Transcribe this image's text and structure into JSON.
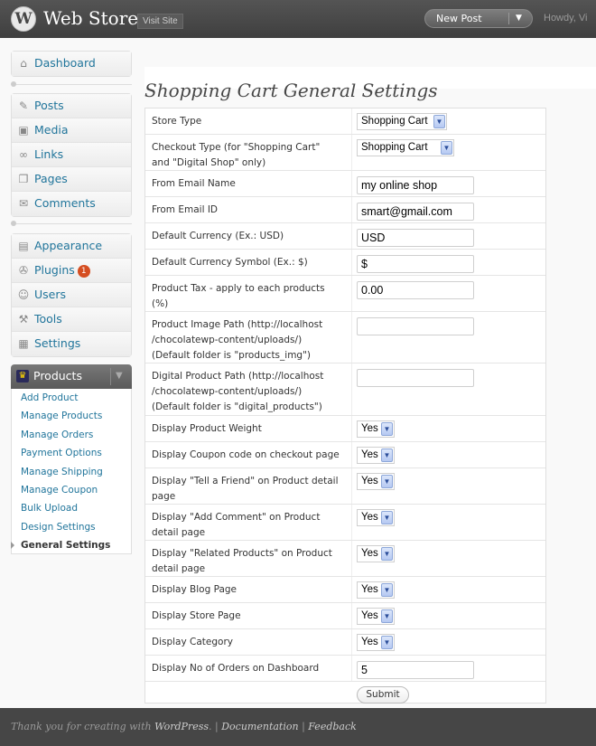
{
  "header": {
    "logo_glyph": "W",
    "site_title": "Web Store",
    "visit_site": "Visit Site",
    "new_post": "New Post",
    "new_post_arrow": "▼",
    "howdy": "Howdy, Vi"
  },
  "sidebar": {
    "group1": [
      {
        "label": "Dashboard",
        "icon": "house-icon",
        "glyph": "⌂"
      }
    ],
    "group2": [
      {
        "label": "Posts",
        "icon": "pin-icon",
        "glyph": "✎"
      },
      {
        "label": "Media",
        "icon": "media-icon",
        "glyph": "▣"
      },
      {
        "label": "Links",
        "icon": "link-icon",
        "glyph": "∞"
      },
      {
        "label": "Pages",
        "icon": "pages-icon",
        "glyph": "❐"
      },
      {
        "label": "Comments",
        "icon": "comment-icon",
        "glyph": "✉"
      }
    ],
    "group3": [
      {
        "label": "Appearance",
        "icon": "appearance-icon",
        "glyph": "▤"
      },
      {
        "label": "Plugins",
        "icon": "plugin-icon",
        "glyph": "✇",
        "badge": "1"
      },
      {
        "label": "Users",
        "icon": "users-icon",
        "glyph": "☺"
      },
      {
        "label": "Tools",
        "icon": "tools-icon",
        "glyph": "⚒"
      },
      {
        "label": "Settings",
        "icon": "settings-icon",
        "glyph": "▦"
      }
    ],
    "products": {
      "label": "Products",
      "icon_glyph": "♛",
      "arrow": "▼",
      "items": [
        {
          "label": "Add Product"
        },
        {
          "label": "Manage Products"
        },
        {
          "label": "Manage Orders"
        },
        {
          "label": "Payment Options"
        },
        {
          "label": "Manage Shipping"
        },
        {
          "label": "Manage Coupon"
        },
        {
          "label": "Bulk Upload"
        },
        {
          "label": "Design Settings"
        },
        {
          "label": "General Settings",
          "current": true
        }
      ]
    }
  },
  "main": {
    "title": "Shopping Cart General Settings",
    "select_arrow": "▼",
    "rows": [
      {
        "label": [
          "Store Type"
        ],
        "type": "select",
        "value": "Shopping Cart"
      },
      {
        "label": [
          "Checkout Type (for \"Shopping Cart\"",
          "and \"Digital Shop\" only)"
        ],
        "type": "select",
        "value": "Shopping Cart"
      },
      {
        "label": [
          "From Email Name"
        ],
        "type": "text",
        "value": "my online shop"
      },
      {
        "label": [
          "From Email ID"
        ],
        "type": "text",
        "value": "smart@gmail.com"
      },
      {
        "label": [
          "Default Currency (Ex.: USD)"
        ],
        "type": "text",
        "value": "USD"
      },
      {
        "label": [
          "Default Currency Symbol (Ex.: $)"
        ],
        "type": "text",
        "value": "$"
      },
      {
        "label": [
          "Product Tax - apply to each products",
          "(%)"
        ],
        "type": "text",
        "value": "0.00"
      },
      {
        "label": [
          "Product Image Path (http://localhost",
          "/chocolatewp-content/uploads/)",
          "(Default folder is \"products_img\")"
        ],
        "type": "text",
        "value": ""
      },
      {
        "label": [
          "Digital Product Path (http://localhost",
          "/chocolatewp-content/uploads/)",
          "(Default folder is \"digital_products\")"
        ],
        "type": "text",
        "value": ""
      },
      {
        "label": [
          "Display Product Weight"
        ],
        "type": "select",
        "value": "Yes"
      },
      {
        "label": [
          "Display Coupon code on checkout page"
        ],
        "type": "select",
        "value": "Yes"
      },
      {
        "label": [
          "Display \"Tell a Friend\" on Product detail",
          "page"
        ],
        "type": "select",
        "value": "Yes"
      },
      {
        "label": [
          "Display \"Add Comment\" on Product",
          "detail page"
        ],
        "type": "select",
        "value": "Yes"
      },
      {
        "label": [
          "Display \"Related Products\" on Product",
          "detail page"
        ],
        "type": "select",
        "value": "Yes"
      },
      {
        "label": [
          "Display Blog Page"
        ],
        "type": "select",
        "value": "Yes"
      },
      {
        "label": [
          "Display Store Page"
        ],
        "type": "select",
        "value": "Yes"
      },
      {
        "label": [
          "Display Category"
        ],
        "type": "select",
        "value": "Yes"
      },
      {
        "label": [
          "Display No of Orders on Dashboard"
        ],
        "type": "text",
        "value": "5"
      }
    ],
    "submit_label": "Submit"
  },
  "footer": {
    "thanks": "Thank you for creating with ",
    "wordpress": "WordPress",
    "sep1": ". | ",
    "documentation": "Documentation",
    "sep2": " | ",
    "feedback": "Feedback"
  }
}
